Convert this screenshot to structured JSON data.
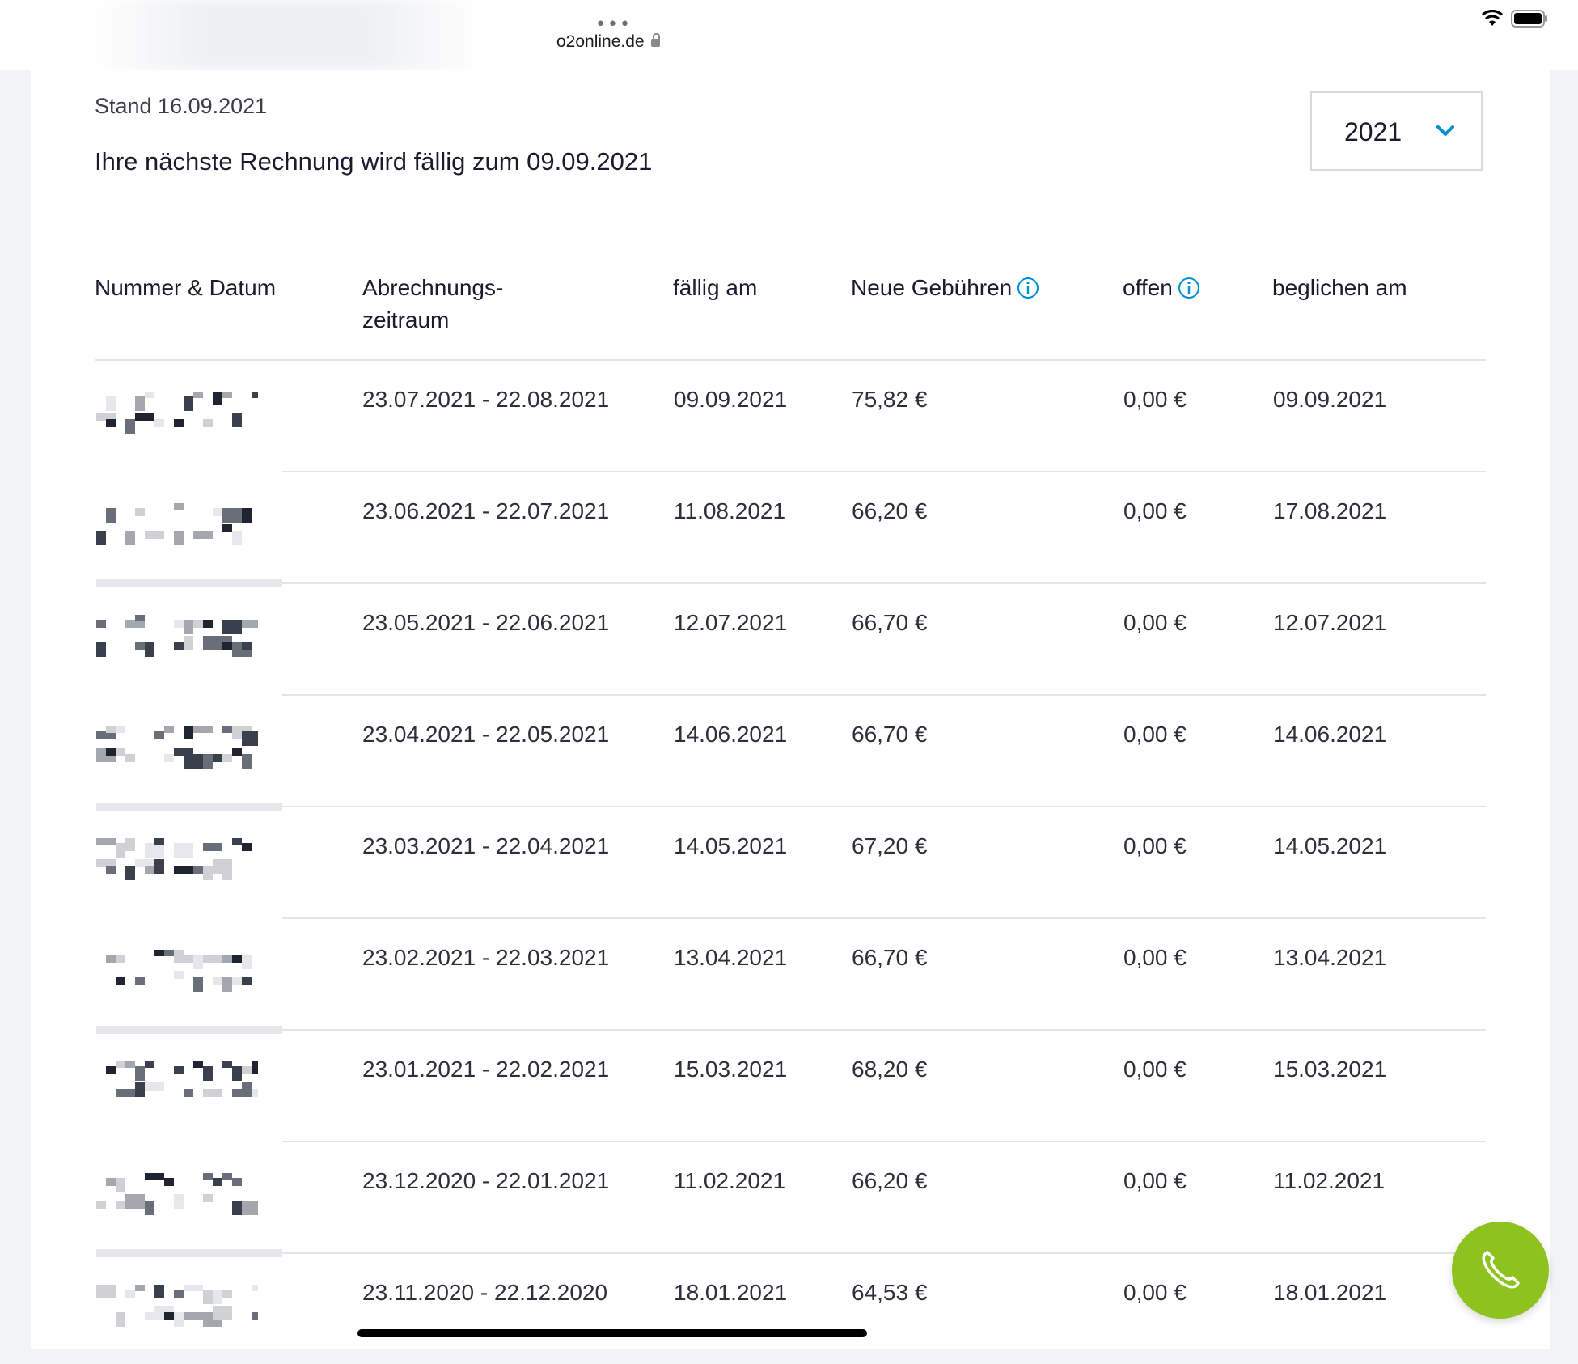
{
  "browser": {
    "url": "o2online.de",
    "dots": "•••"
  },
  "header": {
    "stand": "Stand 16.09.2021",
    "next_bill": "Ihre nächste Rechnung wird fällig zum 09.09.2021",
    "year_select": {
      "value": "2021"
    }
  },
  "table": {
    "columns": {
      "num": "Nummer & Datum",
      "zeit_1": "Abrechnungs-",
      "zeit_2": "zeitraum",
      "faellig": "fällig am",
      "neu": "Neue Gebühren",
      "offen": "offen",
      "begl": "beglichen am"
    },
    "rows": [
      {
        "zeit": "23.07.2021 - 22.08.2021",
        "faellig": "09.09.2021",
        "neu": "75,82 €",
        "offen": "0,00 €",
        "begl": "09.09.2021"
      },
      {
        "zeit": "23.06.2021 - 22.07.2021",
        "faellig": "11.08.2021",
        "neu": "66,20 €",
        "offen": "0,00 €",
        "begl": "17.08.2021"
      },
      {
        "zeit": "23.05.2021 - 22.06.2021",
        "faellig": "12.07.2021",
        "neu": "66,70 €",
        "offen": "0,00 €",
        "begl": "12.07.2021"
      },
      {
        "zeit": "23.04.2021 - 22.05.2021",
        "faellig": "14.06.2021",
        "neu": "66,70 €",
        "offen": "0,00 €",
        "begl": "14.06.2021"
      },
      {
        "zeit": "23.03.2021 - 22.04.2021",
        "faellig": "14.05.2021",
        "neu": "67,20 €",
        "offen": "0,00 €",
        "begl": "14.05.2021"
      },
      {
        "zeit": "23.02.2021 - 22.03.2021",
        "faellig": "13.04.2021",
        "neu": "66,70 €",
        "offen": "0,00 €",
        "begl": "13.04.2021"
      },
      {
        "zeit": "23.01.2021 - 22.02.2021",
        "faellig": "15.03.2021",
        "neu": "68,20 €",
        "offen": "0,00 €",
        "begl": "15.03.2021"
      },
      {
        "zeit": "23.12.2020 - 22.01.2021",
        "faellig": "11.02.2021",
        "neu": "66,20 €",
        "offen": "0,00 €",
        "begl": "11.02.2021"
      },
      {
        "zeit": "23.11.2020 - 22.12.2020",
        "faellig": "18.01.2021",
        "neu": "64,53 €",
        "offen": "0,00 €",
        "begl": "18.01.2021"
      }
    ]
  },
  "colors": {
    "accent": "#0090d0",
    "fab": "#8dc21f"
  },
  "icons": [
    "wifi-icon",
    "battery-icon",
    "lock-icon",
    "chevron-down-icon",
    "info-icon",
    "phone-icon"
  ]
}
